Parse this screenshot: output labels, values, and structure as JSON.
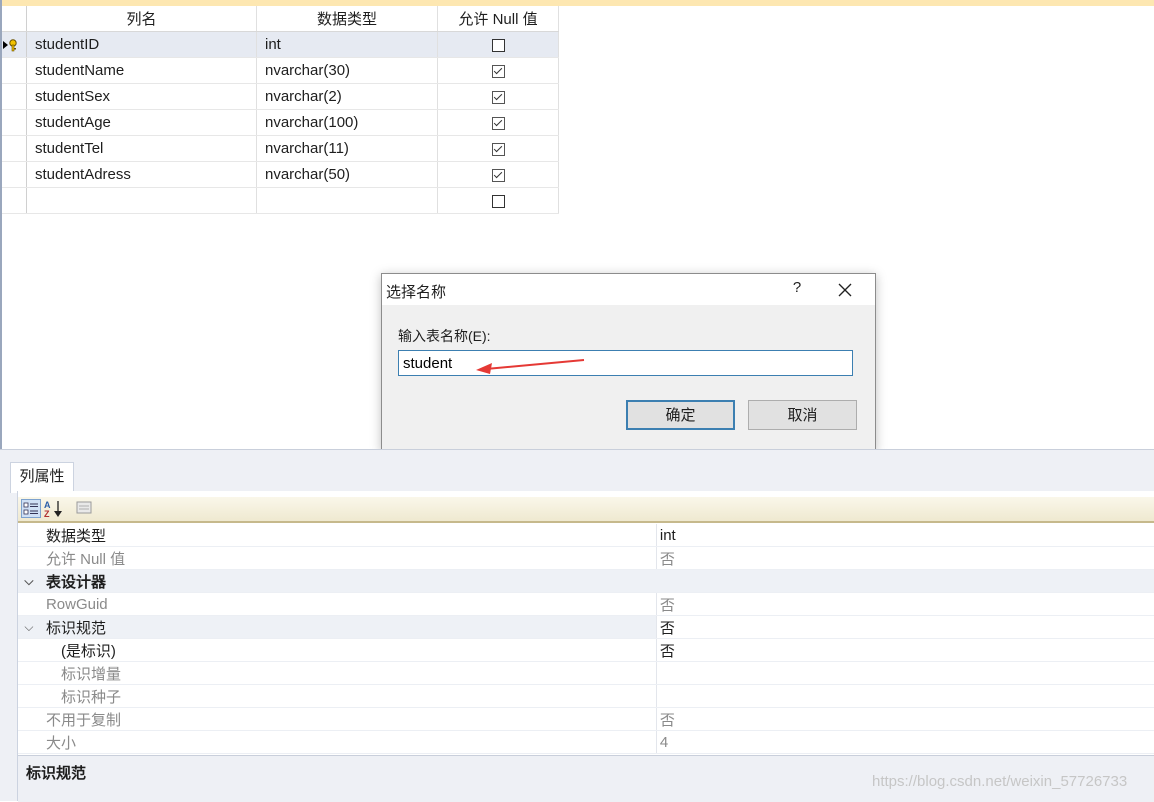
{
  "grid": {
    "headers": [
      "列名",
      "数据类型",
      "允许 Null 值"
    ],
    "rows": [
      {
        "name": "studentID",
        "type": "int",
        "nullable": false
      },
      {
        "name": "studentName",
        "type": "nvarchar(30)",
        "nullable": true
      },
      {
        "name": "studentSex",
        "type": "nvarchar(2)",
        "nullable": true
      },
      {
        "name": "studentAge",
        "type": "nvarchar(100)",
        "nullable": true
      },
      {
        "name": "studentTel",
        "type": "nvarchar(11)",
        "nullable": true
      },
      {
        "name": "studentAdress",
        "type": "nvarchar(50)",
        "nullable": true
      }
    ]
  },
  "dialog": {
    "title": "选择名称",
    "help": "?",
    "label": "输入表名称(E):",
    "input_value": "student",
    "ok_label": "确定",
    "cancel_label": "取消"
  },
  "properties": {
    "tab": "列属性",
    "rows": [
      {
        "name": "数据类型",
        "value": "int"
      },
      {
        "name": "允许 Null 值",
        "value": "否"
      },
      {
        "name": "表设计器"
      },
      {
        "name": "RowGuid",
        "value": "否"
      },
      {
        "name": "标识规范",
        "value": "否"
      },
      {
        "name": "(是标识)",
        "value": "否"
      },
      {
        "name": "标识增量"
      },
      {
        "name": "标识种子"
      },
      {
        "name": "不用于复制",
        "value": "否"
      },
      {
        "name": "大小",
        "value": "4"
      }
    ],
    "description_title": "标识规范"
  },
  "watermark": "https://blog.csdn.net/weixin_57726733",
  "colors": {
    "accent": "#3c7fb1",
    "header_strip": "#fde7b1",
    "arrow": "#e53935"
  }
}
